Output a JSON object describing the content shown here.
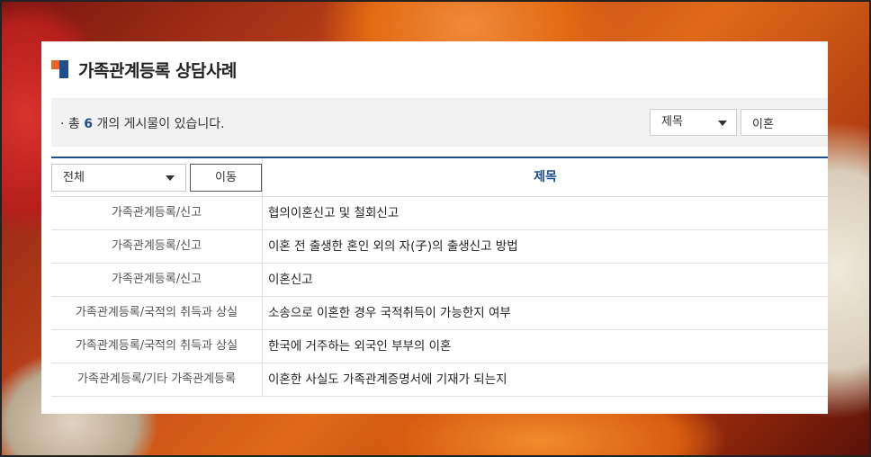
{
  "page": {
    "title": "가족관계등록 상담사례"
  },
  "info": {
    "prefix": "총",
    "count": "6",
    "suffix": "개의 게시물이 있습니다."
  },
  "search": {
    "field_selected": "제목",
    "query": "이혼"
  },
  "table": {
    "category_selected": "전체",
    "move_label": "이동",
    "header_title": "제목",
    "rows": [
      {
        "category": "가족관계등록/신고",
        "title": "협의이혼신고 및 철회신고"
      },
      {
        "category": "가족관계등록/신고",
        "title": "이혼 전 출생한 혼인 외의 자(子)의 출생신고 방법"
      },
      {
        "category": "가족관계등록/신고",
        "title": "이혼신고"
      },
      {
        "category": "가족관계등록/국적의 취득과 상실",
        "title": "소송으로 이혼한 경우 국적취득이 가능한지 여부"
      },
      {
        "category": "가족관계등록/국적의 취득과 상실",
        "title": "한국에 거주하는 외국인 부부의 이혼"
      },
      {
        "category": "가족관계등록/기타 가족관계등록",
        "title": "이혼한 사실도 가족관계증명서에 기재가 되는지"
      }
    ]
  },
  "colors": {
    "accent_blue": "#1f4e8c",
    "accent_orange": "#e8642a"
  }
}
